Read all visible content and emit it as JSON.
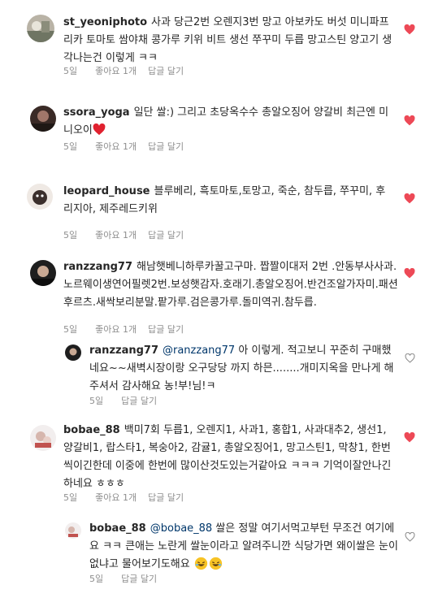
{
  "colors": {
    "heart_red": "#ed4956",
    "text": "#262626",
    "meta": "#8e8e8e",
    "mention": "#00376b"
  },
  "comments": [
    {
      "username": "st_yeoniphoto",
      "text": "사과 당근2번 오렌지3번 망고 아보카도 버섯 미니파프리카 토마토 쌈야채 콩가루 키위 비트 생선 쭈꾸미 두릅 망고스틴 양고기 생각나는건 이렇게 ㅋㅋ",
      "time": "5일",
      "likes": "좋아요 1개",
      "reply": "답글 달기",
      "liked": true
    },
    {
      "username": "ssora_yoga",
      "text": "일단 쌀:) 그리고 초당옥수수 총알오징어 양갈비 최근엔 미니오이",
      "emoji": "red-heart-emoji",
      "time": "5일",
      "likes": "좋아요 1개",
      "reply": "답글 달기",
      "liked": true
    },
    {
      "username": "leopard_house",
      "text": "블루베리, 흑토마토,토망고, 죽순, 참두릅, 쭈꾸미, 후리지아, 제주레드키위",
      "time": "5일",
      "likes": "좋아요 1개",
      "reply": "답글 달기",
      "liked": true
    },
    {
      "username": "ranzzang77",
      "text": "해남햇베니하루카꿀고구마. 짭짤이대저 2번 .안동부사사과.노르웨이생연어필렛2번.보성햇감자.호래기.총알오징어.반건조알가자미.패션후르츠.새싹보리분말.팥가루.검은콩가루.돌미역귀.참두릅.",
      "time": "5일",
      "likes": "좋아요 1개",
      "reply": "답글 달기",
      "liked": true
    },
    {
      "username": "ranzzang77",
      "mention": "@ranzzang77",
      "text": "아 이렇게. 적고보니 꾸준히 구매했네요~~새벽시장이랑 오구당당 까지 하믄........개미지옥을 만나게 해주셔서 감사해요 농!부!님!ㅋ",
      "time": "5일",
      "reply": "답글 달기",
      "liked": false
    },
    {
      "username": "bobae_88",
      "text": "백미7회 두릅1, 오렌지1, 사과1, 홍합1, 사과대추2, 생선1, 양갈비1, 랍스타1, 복숭아2, 감귤1, 총알오징어1, 망고스틴1, 막창1, 한번씩이긴한데 이중에 한번에 많이산것도있는거같아요 ㅋㅋㅋ 기억이잘안나긴하네요 ㅎㅎㅎ",
      "time": "5일",
      "likes": "좋아요 1개",
      "reply": "답글 달기",
      "liked": true
    },
    {
      "username": "bobae_88",
      "mention": "@bobae_88",
      "text": "쌀은 정말 여기서먹고부턴 무조건 여기에요 ㅋㅋ 큰애는 노란게 쌀눈이라고 알려주니깐 식당가면 왜이쌀은 눈이없냐고 물어보기도해요",
      "emoji": "laughing-emoji",
      "time": "5일",
      "reply": "답글 달기",
      "liked": false
    }
  ]
}
